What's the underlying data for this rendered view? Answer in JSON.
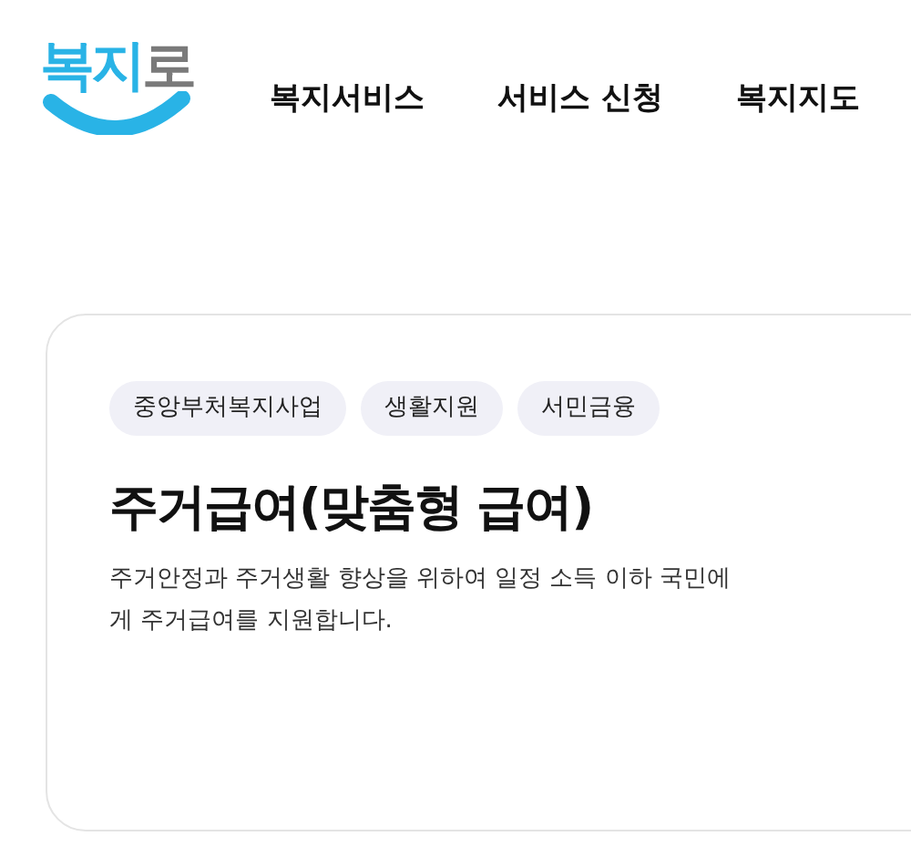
{
  "logo": {
    "parts": [
      {
        "text": "복지",
        "color": "#29b3e6"
      },
      {
        "text": "로",
        "color": "#7a7a7a"
      }
    ]
  },
  "nav": [
    {
      "label": "복지서비스"
    },
    {
      "label": "서비스 신청"
    },
    {
      "label": "복지지도"
    }
  ],
  "card": {
    "tags": [
      "중앙부처복지사업",
      "생활지원",
      "서민금융"
    ],
    "title": "주거급여(맞춤형 급여)",
    "description": "주거안정과 주거생활 향상을 위하여 일정 소득 이하 국민에게 주거급여를 지원합니다."
  }
}
